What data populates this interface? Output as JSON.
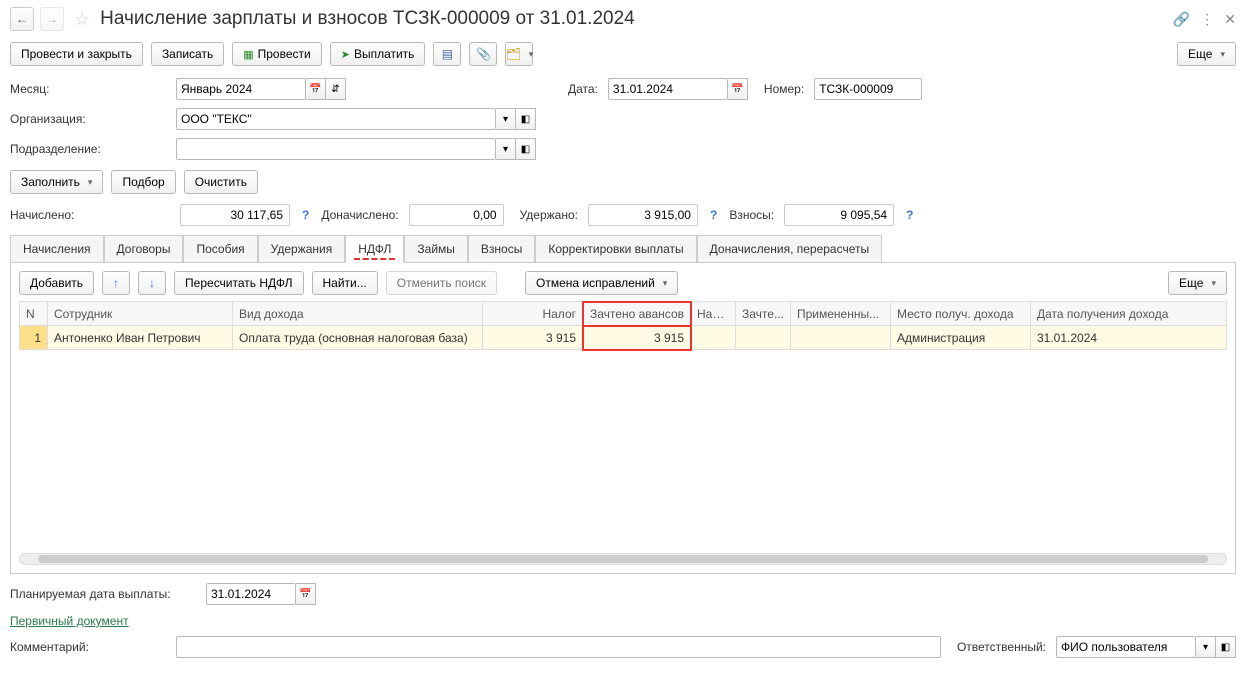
{
  "title": "Начисление зарплаты и взносов ТСЗК-000009 от 31.01.2024",
  "toolbar": {
    "post_close": "Провести и закрыть",
    "save": "Записать",
    "post": "Провести",
    "pay": "Выплатить",
    "more": "Еще"
  },
  "form": {
    "month_label": "Месяц:",
    "month_value": "Январь 2024",
    "date_label": "Дата:",
    "date_value": "31.01.2024",
    "number_label": "Номер:",
    "number_value": "ТСЗК-000009",
    "org_label": "Организация:",
    "org_value": "ООО \"ТЕКС\"",
    "dept_label": "Подразделение:",
    "dept_value": ""
  },
  "actions": {
    "fill": "Заполнить",
    "pick": "Подбор",
    "clear": "Очистить"
  },
  "sums": {
    "accrued_label": "Начислено:",
    "accrued": "30 117,65",
    "addl_label": "Доначислено:",
    "addl": "0,00",
    "withheld_label": "Удержано:",
    "withheld": "3 915,00",
    "contrib_label": "Взносы:",
    "contrib": "9 095,54"
  },
  "tabs": {
    "accruals": "Начисления",
    "contracts": "Договоры",
    "benefits": "Пособия",
    "deductions": "Удержания",
    "ndfl": "НДФЛ",
    "loans": "Займы",
    "contribs": "Взносы",
    "corrections": "Корректировки выплаты",
    "recalc": "Доначисления, перерасчеты"
  },
  "grid_toolbar": {
    "add": "Добавить",
    "recalc_ndfl": "Пересчитать НДФЛ",
    "find": "Найти...",
    "cancel_find": "Отменить поиск",
    "cancel_fixes": "Отмена исправлений",
    "more": "Еще"
  },
  "columns": {
    "n": "N",
    "employee": "Сотрудник",
    "income_kind": "Вид дохода",
    "tax": "Налог",
    "advance_offset": "Зачтено авансов",
    "tax_short": "Нал...",
    "offset_short": "Зачте...",
    "applied": "Примененны...",
    "place": "Место получ. дохода",
    "income_date": "Дата получения дохода"
  },
  "rows": [
    {
      "n": "1",
      "employee": "Антоненко Иван Петрович",
      "income_kind": "Оплата труда (основная налоговая база)",
      "tax": "3 915",
      "advance_offset": "3 915",
      "tax_short": "",
      "offset_short": "",
      "applied": "",
      "place": "Администрация",
      "income_date": "31.01.2024"
    }
  ],
  "footer": {
    "planned_pay_label": "Планируемая дата выплаты:",
    "planned_pay": "31.01.2024",
    "primary_doc": "Первичный документ",
    "comment_label": "Комментарий:",
    "comment": "",
    "responsible_label": "Ответственный:",
    "responsible": "ФИО пользователя"
  }
}
